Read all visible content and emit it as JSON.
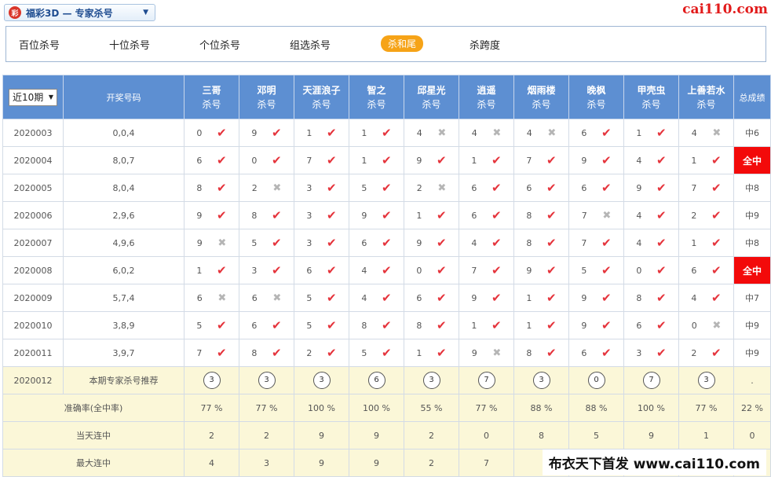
{
  "top_select": {
    "logo_text": "彩",
    "title": "福彩3D — 专家杀号"
  },
  "site_logo": "cai110.com",
  "tabs": [
    {
      "label": "百位杀号",
      "active": false
    },
    {
      "label": "十位杀号",
      "active": false
    },
    {
      "label": "个位杀号",
      "active": false
    },
    {
      "label": "组选杀号",
      "active": false
    },
    {
      "label": "杀和尾",
      "active": true
    },
    {
      "label": "杀跨度",
      "active": false
    }
  ],
  "table": {
    "period_select": "近10期",
    "col_draw": "开奖号码",
    "col_total": "总成绩",
    "sub_label": "杀号",
    "experts": [
      "三哥",
      "邓明",
      "天涯浪子",
      "智之",
      "邱星光",
      "逍遥",
      "烟雨楼",
      "晚枫",
      "甲壳虫",
      "上善若水"
    ],
    "rows": [
      {
        "issue": "2020003",
        "draw": "0,0,4",
        "cells": [
          [
            0,
            1
          ],
          [
            9,
            1
          ],
          [
            1,
            1
          ],
          [
            1,
            1
          ],
          [
            4,
            0
          ],
          [
            4,
            0
          ],
          [
            4,
            0
          ],
          [
            6,
            1
          ],
          [
            1,
            1
          ],
          [
            4,
            0
          ]
        ],
        "total": "中6",
        "all": false
      },
      {
        "issue": "2020004",
        "draw": "8,0,7",
        "cells": [
          [
            6,
            1
          ],
          [
            0,
            1
          ],
          [
            7,
            1
          ],
          [
            1,
            1
          ],
          [
            9,
            1
          ],
          [
            1,
            1
          ],
          [
            7,
            1
          ],
          [
            9,
            1
          ],
          [
            4,
            1
          ],
          [
            1,
            1
          ]
        ],
        "total": "全中",
        "all": true
      },
      {
        "issue": "2020005",
        "draw": "8,0,4",
        "cells": [
          [
            8,
            1
          ],
          [
            2,
            0
          ],
          [
            3,
            1
          ],
          [
            5,
            1
          ],
          [
            2,
            0
          ],
          [
            6,
            1
          ],
          [
            6,
            1
          ],
          [
            6,
            1
          ],
          [
            9,
            1
          ],
          [
            7,
            1
          ]
        ],
        "total": "中8",
        "all": false
      },
      {
        "issue": "2020006",
        "draw": "2,9,6",
        "cells": [
          [
            9,
            1
          ],
          [
            8,
            1
          ],
          [
            3,
            1
          ],
          [
            9,
            1
          ],
          [
            1,
            1
          ],
          [
            6,
            1
          ],
          [
            8,
            1
          ],
          [
            7,
            0
          ],
          [
            4,
            1
          ],
          [
            2,
            1
          ]
        ],
        "total": "中9",
        "all": false
      },
      {
        "issue": "2020007",
        "draw": "4,9,6",
        "cells": [
          [
            9,
            0
          ],
          [
            5,
            1
          ],
          [
            3,
            1
          ],
          [
            6,
            1
          ],
          [
            9,
            1
          ],
          [
            4,
            1
          ],
          [
            8,
            1
          ],
          [
            7,
            1
          ],
          [
            4,
            1
          ],
          [
            1,
            1
          ]
        ],
        "total": "中8",
        "all": false
      },
      {
        "issue": "2020008",
        "draw": "6,0,2",
        "cells": [
          [
            1,
            1
          ],
          [
            3,
            1
          ],
          [
            6,
            1
          ],
          [
            4,
            1
          ],
          [
            0,
            1
          ],
          [
            7,
            1
          ],
          [
            9,
            1
          ],
          [
            5,
            1
          ],
          [
            0,
            1
          ],
          [
            6,
            1
          ]
        ],
        "total": "全中",
        "all": true
      },
      {
        "issue": "2020009",
        "draw": "5,7,4",
        "cells": [
          [
            6,
            0
          ],
          [
            6,
            0
          ],
          [
            5,
            1
          ],
          [
            4,
            1
          ],
          [
            6,
            1
          ],
          [
            9,
            1
          ],
          [
            1,
            1
          ],
          [
            9,
            1
          ],
          [
            8,
            1
          ],
          [
            4,
            1
          ]
        ],
        "total": "中7",
        "all": false
      },
      {
        "issue": "2020010",
        "draw": "3,8,9",
        "cells": [
          [
            5,
            1
          ],
          [
            6,
            1
          ],
          [
            5,
            1
          ],
          [
            8,
            1
          ],
          [
            8,
            1
          ],
          [
            1,
            1
          ],
          [
            1,
            1
          ],
          [
            9,
            1
          ],
          [
            6,
            1
          ],
          [
            0,
            0
          ]
        ],
        "total": "中9",
        "all": false
      },
      {
        "issue": "2020011",
        "draw": "3,9,7",
        "cells": [
          [
            7,
            1
          ],
          [
            8,
            1
          ],
          [
            2,
            1
          ],
          [
            5,
            1
          ],
          [
            1,
            1
          ],
          [
            9,
            0
          ],
          [
            8,
            1
          ],
          [
            6,
            1
          ],
          [
            3,
            1
          ],
          [
            2,
            1
          ]
        ],
        "total": "中9",
        "all": false
      }
    ],
    "recommend": {
      "issue": "2020012",
      "label": "本期专家杀号推荐",
      "values": [
        "3",
        "3",
        "3",
        "6",
        "3",
        "7",
        "3",
        "0",
        "7",
        "3"
      ],
      "total": "."
    },
    "accuracy": {
      "label": "准确率(全中率)",
      "values": [
        "77 %",
        "77 %",
        "100 %",
        "100 %",
        "55 %",
        "77 %",
        "88 %",
        "88 %",
        "100 %",
        "77 %"
      ],
      "total": "22 %"
    },
    "current_streak": {
      "label": "当天连中",
      "values": [
        "2",
        "2",
        "9",
        "9",
        "2",
        "0",
        "8",
        "5",
        "9",
        "1"
      ],
      "total": "0"
    },
    "max_streak": {
      "label": "最大连中",
      "values": [
        "4",
        "3",
        "9",
        "9",
        "2",
        "7",
        "",
        "",
        "",
        ""
      ],
      "total": ""
    }
  },
  "watermark": "布衣天下首发 www.cai110.com",
  "icons": {
    "hit": "check-icon",
    "miss": "cross-icon"
  },
  "colors": {
    "header_bg": "#5d8fd2",
    "hit": "#e5343c",
    "all_hit": "#f30a0a",
    "tab_active": "#f6a317"
  }
}
